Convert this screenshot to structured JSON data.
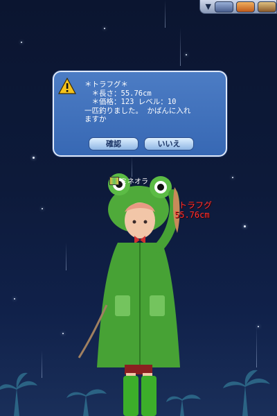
{
  "dialog": {
    "icon": "warning-icon",
    "lines": [
      "＊トラフグ＊",
      "　＊長さ：55.76cm",
      "　＊価格：123 レベル：10",
      "一匹釣りました。 かばんに入れ",
      "ますか"
    ],
    "confirm_label": "確認",
    "cancel_label": "いいえ"
  },
  "player": {
    "name": "ミネオラ"
  },
  "catch": {
    "fish_name": "トラフグ",
    "length": "55.76cm"
  },
  "colors": {
    "dialog_bg": "#3f70ba",
    "catch_text": "#ff3030",
    "sky": "#0d1a3a"
  }
}
